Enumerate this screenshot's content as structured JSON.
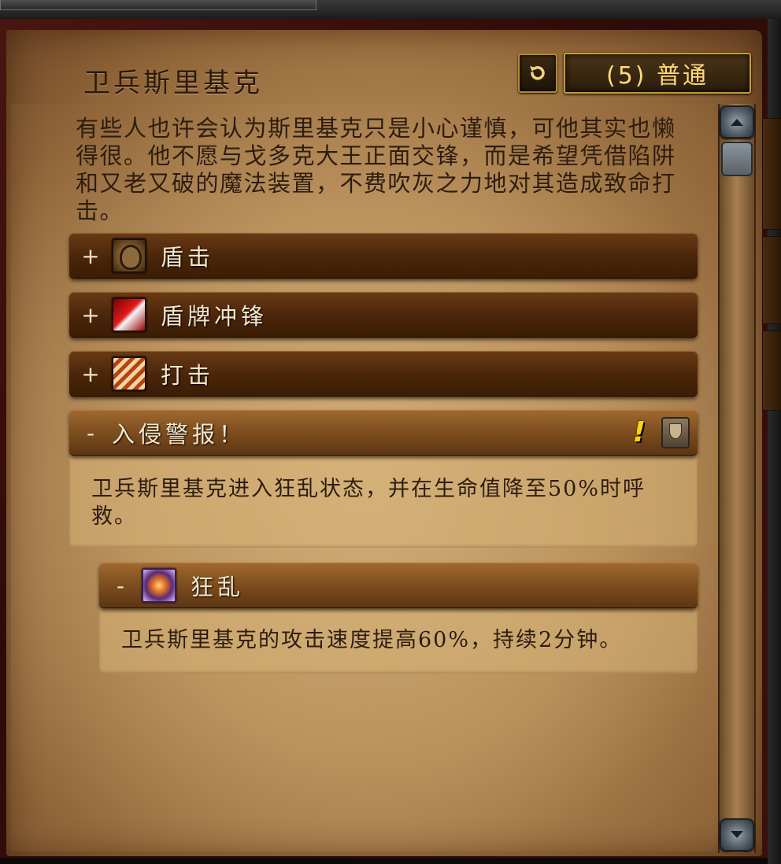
{
  "encounter": {
    "title": "卫兵斯里基克",
    "difficulty_label": "(5) 普通",
    "description": "有些人也许会认为斯里基克只是小心谨慎，可他其实也懒得很。他不愿与戈多克大王正面交锋，而是希望凭借陷阱和又老又破的魔法装置，不费吹灰之力地对其造成致命打击。"
  },
  "abilities": [
    {
      "toggle": "+",
      "label": "盾击",
      "icon": "shield-bash-icon"
    },
    {
      "toggle": "+",
      "label": "盾牌冲锋",
      "icon": "shield-charge-icon"
    },
    {
      "toggle": "+",
      "label": "打击",
      "icon": "strike-icon"
    }
  ],
  "alert_section": {
    "toggle": "-",
    "label": "入侵警报！",
    "body": "卫兵斯里基克进入狂乱状态，并在生命值降至50%时呼救。",
    "important_mark": "!",
    "role_icon": "tank-shield-icon"
  },
  "frenzy_section": {
    "toggle": "-",
    "label": "狂乱",
    "icon": "frenzy-icon",
    "body": "卫兵斯里基克的攻击速度提高60%，持续2分钟。"
  },
  "colors": {
    "parchment": "#b68c57",
    "header_dark": "#4a2509",
    "header_light": "#7c4d1e",
    "gold_border": "#c79a30",
    "difficulty_text": "#ffd97a",
    "alert_yellow": "#ffd21a"
  }
}
